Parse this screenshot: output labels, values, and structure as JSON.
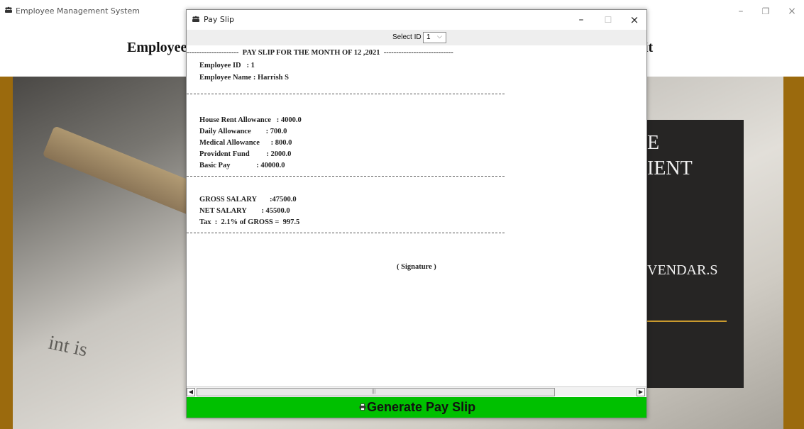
{
  "main_window": {
    "title": "Employee Management System",
    "heading_left": "Employee",
    "heading_right": "it",
    "controls": {
      "minimize": "–",
      "restore": "❐",
      "close": "×"
    },
    "overlay": {
      "line1": "E",
      "line2": "IENT",
      "line3": "VENDAR.S"
    },
    "photo_text": "int is"
  },
  "dialog": {
    "title": "Pay Slip",
    "controls": {
      "minimize": "–",
      "maximize": "☐",
      "close": "×"
    },
    "select": {
      "label": "Select ID",
      "value": "1",
      "arrow": "⌵"
    },
    "slip": {
      "header": "---------------------  PAY SLIP FOR THE MONTH OF 12 ,2021  ----------------------------",
      "employee_id": "Employee ID   : 1",
      "employee_name": "Employee Name : Harrish S",
      "hra": "House Rent Allowance   : 4000.0",
      "da": "Daily Allowance        : 700.0",
      "ma": "Medical Allowance      : 800.0",
      "pf": "Provident Fund         : 2000.0",
      "basic": "Basic Pay              : 40000.0",
      "gross": "GROSS SALARY       :47500.0",
      "net": "NET SALARY        : 45500.0",
      "tax": "Tax  :  2.1% of GROSS =  997.5",
      "signature": "( Signature )"
    },
    "scrollbar": {
      "left": "◀",
      "right": "▶",
      "grip": "|||"
    },
    "generate_button": {
      "label": "Generate Pay Slip"
    }
  },
  "colors": {
    "generate_button": "#00c000",
    "hero_frame": "#9b6a0d",
    "overlay_panel": "#262524",
    "overlay_accent": "#c99a2e"
  }
}
